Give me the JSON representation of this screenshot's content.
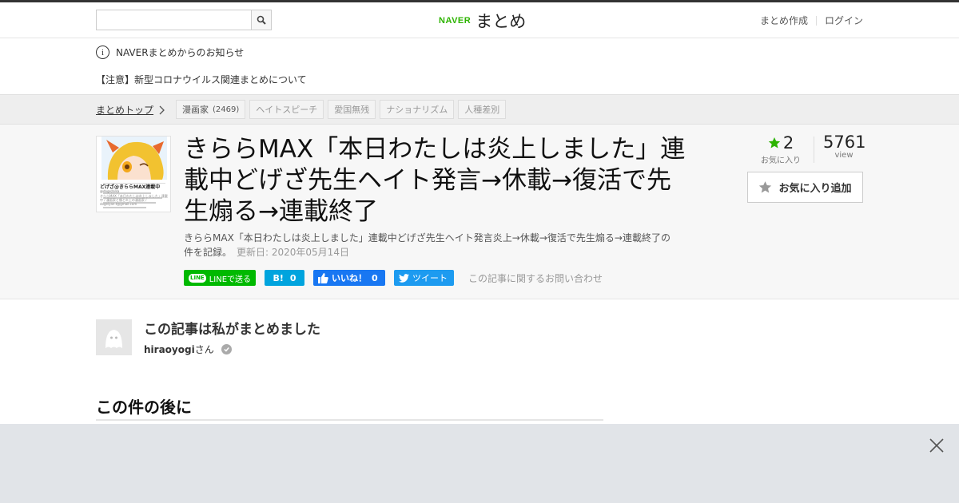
{
  "header": {
    "search_placeholder": "",
    "logo_brand": "NAVER",
    "logo_text": "まとめ",
    "link_create": "まとめ作成",
    "link_login": "ログイン"
  },
  "notice": {
    "title": "NAVERまとめからのお知らせ",
    "link": "【注意】新型コロナウイルス関連まとめについて"
  },
  "breadcrumb": {
    "top_label": "まとめトップ"
  },
  "tags": [
    {
      "label": "漫画家",
      "count": "(2469)"
    },
    {
      "label": "ヘイトスピーチ"
    },
    {
      "label": "愛国無残"
    },
    {
      "label": "ナショナリズム"
    },
    {
      "label": "人種差別"
    }
  ],
  "article": {
    "title": "きららMAX「本日わたしは炎上しました」連載中どげざ先生ヘイト発言→休載→復活で先生煽る→連載終了",
    "description": "きららMAX「本日わたしは炎上しました」連載中どげざ先生ヘイト発言炎上→休載→復活で先生煽る→連載終了の件を記録。",
    "updated": "更新日: 2020年05月14日"
  },
  "social": {
    "line": "LINEで送る",
    "line_logo": "LINE",
    "hatena_icon": "B!",
    "hatena_count": "0",
    "fb_label": "いいね！",
    "fb_count": "0",
    "tweet": "ツイート",
    "contact": "この記事に関するお問い合わせ"
  },
  "stats": {
    "favorites": "2",
    "favorites_label": "お気に入り",
    "views": "5761",
    "views_label": "view",
    "add_favorite": "お気に入り追加"
  },
  "author": {
    "heading": "この記事は私がまとめました",
    "name": "hiraoyogi",
    "suffix": "さん"
  },
  "section": {
    "heading": "この件の後に"
  },
  "thumbnail": {
    "caption_title": "どげざ@きららMAX連載中",
    "caption_handle": "@dogezaIsa",
    "caption_body": "きららMAX「本日わたしは炎上しました」連載中 / 漫画家と僕と炎上の漫画家 / dogeiyan.t@gmail.com"
  },
  "colors": {
    "naver_green": "#2db400",
    "line_green": "#00b900",
    "hatena_blue": "#00a4de",
    "facebook_blue": "#1877f2",
    "twitter_blue": "#1d9bf0",
    "favorite_star": "#2db400",
    "ad_overlay": "#e1e4e8"
  },
  "icons": [
    "search-icon",
    "info-icon",
    "chevron-right-icon",
    "star-icon",
    "star-outline-icon",
    "check-icon",
    "close-icon",
    "facebook-like-icon",
    "twitter-bird-icon",
    "line-logo-icon"
  ]
}
